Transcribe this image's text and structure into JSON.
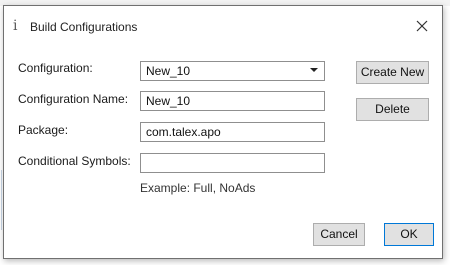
{
  "dialog": {
    "title": "Build Configurations",
    "icon": "info-icon",
    "close_icon": "close-icon"
  },
  "form": {
    "configuration": {
      "label": "Configuration:",
      "value": "New_10"
    },
    "configuration_name": {
      "label": "Configuration Name:",
      "value": "New_10"
    },
    "package": {
      "label": "Package:",
      "value": "com.talex.apo"
    },
    "conditional_symbols": {
      "label": "Conditional Symbols:",
      "value": "",
      "hint": "Example: Full, NoAds"
    }
  },
  "buttons": {
    "create_new": "Create New",
    "delete": "Delete",
    "cancel": "Cancel",
    "ok": "OK"
  },
  "colors": {
    "dialog_border": "#707070",
    "button_face": "#e1e1e1",
    "default_button_border": "#0078d7"
  }
}
